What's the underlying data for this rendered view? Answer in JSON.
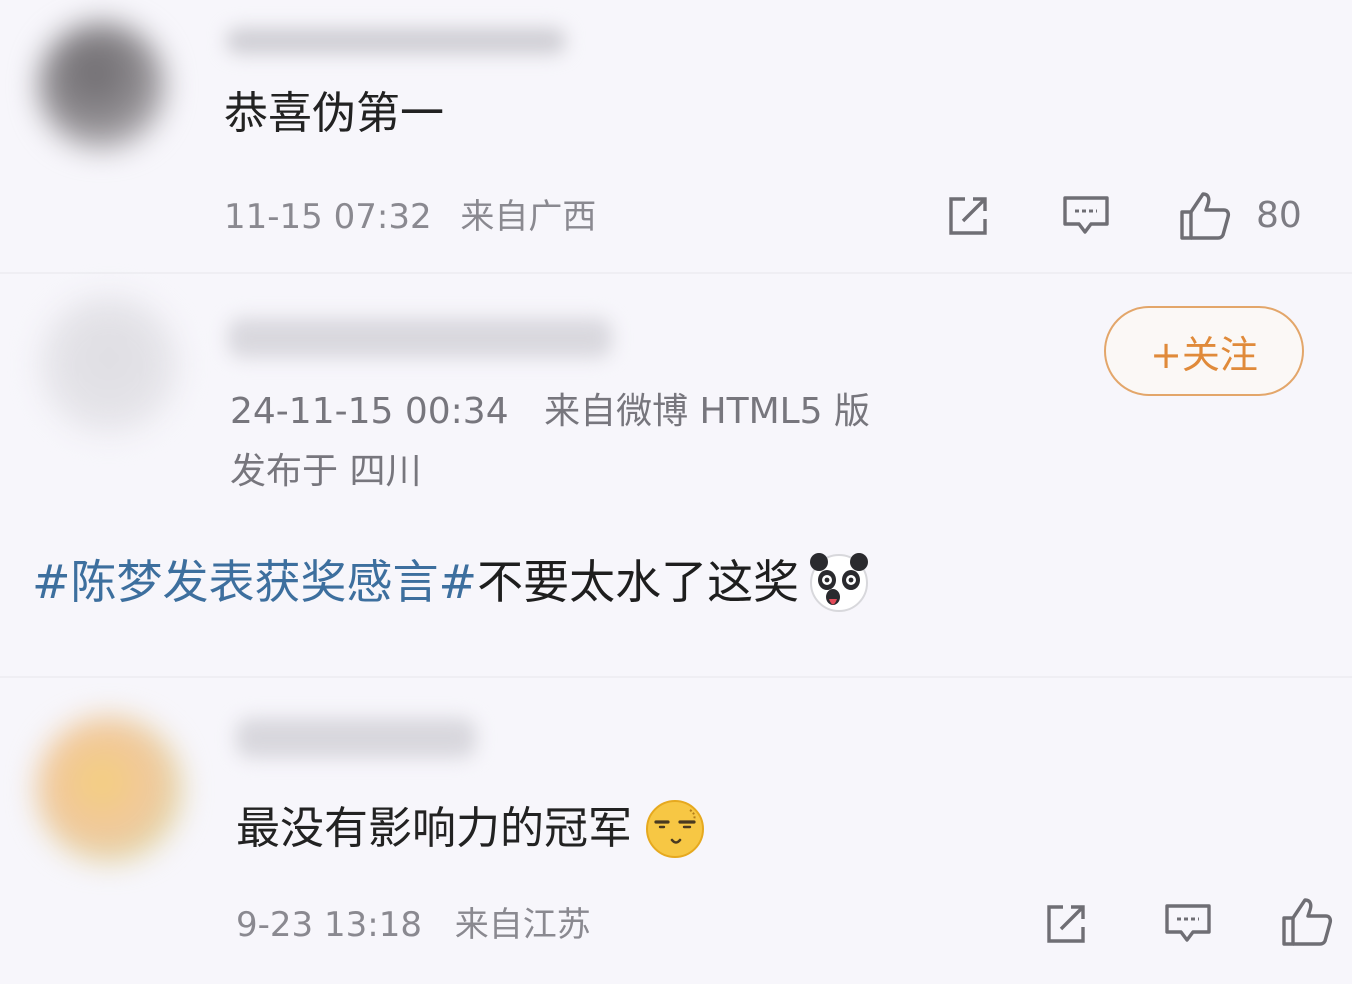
{
  "comments": [
    {
      "text": "恭喜伪第一",
      "time": "11-15 07:32",
      "location": "来自广西",
      "likes": "80"
    },
    {
      "text": "最没有影响力的冠军",
      "time": "9-23 13:18",
      "location": "来自江苏",
      "likes": ""
    }
  ],
  "post": {
    "follow_label": "+关注",
    "time": "24-11-15 00:34",
    "source": "来自微博 HTML5 版",
    "location": "发布于 四川",
    "hashtag": "#陈梦发表获奖感言#",
    "body": "不要太水了这奖"
  },
  "icons": {
    "share": "share-icon",
    "comment": "comment-icon",
    "like": "thumbs-up-icon",
    "emoji_post": "panda-face-emoji",
    "emoji_comment": "speechless-face-emoji"
  },
  "colors": {
    "background": "#f7f6fb",
    "hashtag": "#3d6f9e",
    "follow": "#e08a3a",
    "meta": "#8a8990"
  }
}
